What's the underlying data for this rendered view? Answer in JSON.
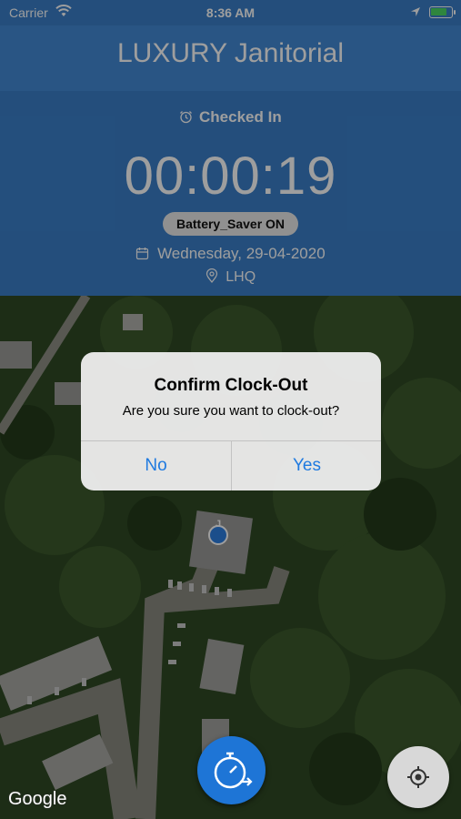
{
  "status_bar": {
    "carrier": "Carrier",
    "time": "8:36 AM"
  },
  "header": {
    "title": "LUXURY Janitorial"
  },
  "session": {
    "status": "Checked In",
    "elapsed": "00:00:19",
    "battery_saver": "Battery_Saver ON",
    "date": "Wednesday, 29-04-2020",
    "location": "LHQ"
  },
  "map": {
    "attribution": "Google",
    "user_marker": "J"
  },
  "dialog": {
    "title": "Confirm Clock-Out",
    "message": "Are you sure you want to clock-out?",
    "no_label": "No",
    "yes_label": "Yes"
  },
  "colors": {
    "header_bg": "#3a7fc9",
    "navbar_bg": "#4389d6",
    "accent": "#1f7ae0"
  },
  "icons": {
    "wifi": "wifi-icon",
    "location_arrow": "location-arrow-icon",
    "battery": "battery-charging-icon",
    "alarm": "alarm-clock-icon",
    "calendar": "calendar-icon",
    "pin": "map-pin-icon",
    "stopwatch": "stopwatch-clock-out-icon",
    "crosshair": "my-location-icon"
  }
}
